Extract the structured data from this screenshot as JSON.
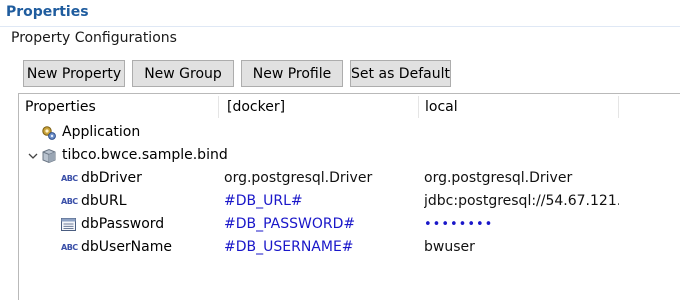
{
  "view": {
    "title": "Properties",
    "section_label": "Property Configurations"
  },
  "toolbar": {
    "new_property": "New Property",
    "new_group": "New Group",
    "new_profile": "New Profile",
    "set_default": "Set as Default"
  },
  "table": {
    "columns": [
      "Properties",
      "[docker]",
      "local"
    ],
    "rows": [
      {
        "name": "Application",
        "icon": "application-icon",
        "docker": "",
        "local": ""
      },
      {
        "name": "tibco.bwce.sample.bind",
        "icon": "group-icon",
        "docker": "",
        "local": "",
        "expanded": true
      },
      {
        "name": "dbDriver",
        "icon": "string-type-icon",
        "docker": "org.postgresql.Driver",
        "local": "org.postgresql.Driver"
      },
      {
        "name": "dbURL",
        "icon": "string-type-icon",
        "docker": "#DB_URL#",
        "local": "jdbc:postgresql://54.67.121...."
      },
      {
        "name": "dbPassword",
        "icon": "password-type-icon",
        "docker": "#DB_PASSWORD#",
        "local": "••••••••"
      },
      {
        "name": "dbUserName",
        "icon": "string-type-icon",
        "docker": "#DB_USERNAME#",
        "local": "bwuser"
      }
    ]
  },
  "icons": {
    "abc_text": "ABC"
  },
  "colors": {
    "title": "#1f5c9e",
    "module_value": "#1a17c9",
    "literal_value": "#111111"
  }
}
